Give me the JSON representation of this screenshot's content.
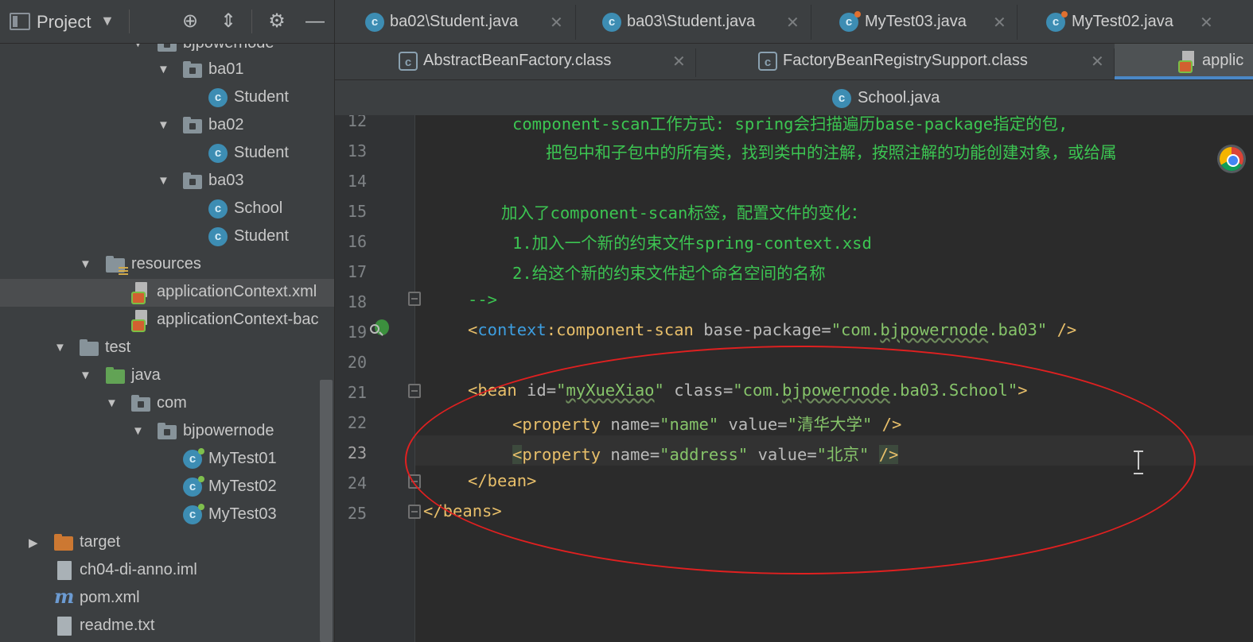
{
  "sidebar": {
    "title": "Project",
    "dropdown_glyph": "▼",
    "buttons": {
      "locate": "⊕",
      "collapse": "⇕",
      "settings": "⚙",
      "minimize": "—"
    },
    "tree": [
      {
        "label": "bjpowernode",
        "type": "package",
        "expanded": true
      },
      {
        "label": "ba01",
        "type": "package",
        "expanded": true
      },
      {
        "label": "Student",
        "type": "class"
      },
      {
        "label": "ba02",
        "type": "package",
        "expanded": true
      },
      {
        "label": "Student",
        "type": "class"
      },
      {
        "label": "ba03",
        "type": "package",
        "expanded": true
      },
      {
        "label": "School",
        "type": "class"
      },
      {
        "label": "Student",
        "type": "class"
      },
      {
        "label": "resources",
        "type": "resources-folder",
        "expanded": true
      },
      {
        "label": "applicationContext.xml",
        "type": "xml",
        "selected": true
      },
      {
        "label": "applicationContext-bac",
        "type": "xml"
      },
      {
        "label": "test",
        "type": "folder",
        "expanded": true
      },
      {
        "label": "java",
        "type": "source-folder",
        "expanded": true
      },
      {
        "label": "com",
        "type": "package",
        "expanded": true
      },
      {
        "label": "bjpowernode",
        "type": "package",
        "expanded": true
      },
      {
        "label": "MyTest01",
        "type": "test-class"
      },
      {
        "label": "MyTest02",
        "type": "test-class"
      },
      {
        "label": "MyTest03",
        "type": "test-class"
      },
      {
        "label": "target",
        "type": "excluded-folder",
        "expanded": false
      },
      {
        "label": "ch04-di-anno.iml",
        "type": "iml"
      },
      {
        "label": "pom.xml",
        "type": "maven"
      },
      {
        "label": "readme.txt",
        "type": "text"
      }
    ]
  },
  "tabs": {
    "row1": [
      {
        "label": "ba02\\Student.java",
        "icon": "class-icon"
      },
      {
        "label": "ba03\\Student.java",
        "icon": "class-icon"
      },
      {
        "label": "MyTest03.java",
        "icon": "test-class-icon"
      },
      {
        "label": "MyTest02.java",
        "icon": "test-class-icon"
      }
    ],
    "row2": [
      {
        "label": "AbstractBeanFactory.class",
        "icon": "class-file-icon"
      },
      {
        "label": "FactoryBeanRegistrySupport.class",
        "icon": "class-file-icon"
      },
      {
        "label": "applic",
        "icon": "xml-icon",
        "active": true
      }
    ],
    "row3": [
      {
        "label": "School.java",
        "icon": "class-icon"
      }
    ],
    "close_glyph": "✕"
  },
  "editor": {
    "current_line": 23,
    "lines": [
      {
        "n": "12",
        "text": "component-scan工作方式: spring会扫描遍历base-package指定的包,"
      },
      {
        "n": "13",
        "text": "把包中和子包中的所有类，找到类中的注解，按照注解的功能创建对象，或给属"
      },
      {
        "n": "14",
        "text": ""
      },
      {
        "n": "15",
        "text": "加入了component-scan标签，配置文件的变化："
      },
      {
        "n": "16",
        "text": "1.加入一个新的约束文件spring-context.xsd"
      },
      {
        "n": "17",
        "text": "2.给这个新的约束文件起个命名空间的名称"
      },
      {
        "n": "18",
        "text": "-->"
      },
      {
        "n": "19",
        "text": "<context:component-scan base-package=\"com.bjpowernode.ba03\" />"
      },
      {
        "n": "20",
        "text": ""
      },
      {
        "n": "21",
        "text": "<bean id=\"myXueXiao\" class=\"com.bjpowernode.ba03.School\">"
      },
      {
        "n": "22",
        "text": "<property name=\"name\" value=\"清华大学\" />"
      },
      {
        "n": "23",
        "text": "<property name=\"address\" value=\"北京\" />"
      },
      {
        "n": "24",
        "text": "</bean>"
      },
      {
        "n": "25",
        "text": "</beans>"
      }
    ],
    "tokens": {
      "l19_open": "<",
      "l19_ns": "context",
      "l19_colon": ":",
      "l19_tag": "component-scan",
      "l19_attr": " base-package",
      "l19_eq": "=",
      "l19_val": "\"com.",
      "l19_val_sq": "bjpowernode",
      "l19_val_end": ".ba03\"",
      "l19_close": " />",
      "l21_open": "<",
      "l21_tag": "bean",
      "l21_a1": " id",
      "l21_eq1": "=",
      "l21_v1q": "\"",
      "l21_v1": "myXueXiao",
      "l21_v1e": "\"",
      "l21_a2": " class",
      "l21_eq2": "=",
      "l21_v2": "\"com.",
      "l21_v2sq": "bjpowernode",
      "l21_v2e": ".ba03.School\"",
      "l21_close": ">",
      "l22_open": "<",
      "l22_tag": "property",
      "l22_a1": " name",
      "l22_eq1": "=",
      "l22_v1": "\"name\"",
      "l22_a2": " value",
      "l22_eq2": "=",
      "l22_v2": "\"清华大学\"",
      "l22_close": " />",
      "l23_open": "<",
      "l23_tag": "property",
      "l23_a1": " name",
      "l23_eq1": "=",
      "l23_v1": "\"address\"",
      "l23_a2": " value",
      "l23_eq2": "=",
      "l23_v2": "\"北京\"",
      "l23_sp": " ",
      "l23_close": "/>",
      "l24": "</bean>",
      "l25_open": "</",
      "l25_tag": "beans",
      "l25_close": ">"
    },
    "annotation_color": "#e02020"
  }
}
